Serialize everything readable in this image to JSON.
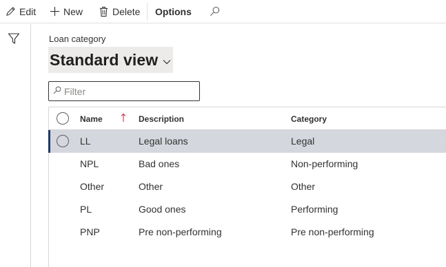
{
  "toolbar": {
    "edit_label": "Edit",
    "new_label": "New",
    "delete_label": "Delete",
    "options_label": "Options"
  },
  "page": {
    "breadcrumb": "Loan category",
    "view_name": "Standard view"
  },
  "filter": {
    "placeholder": "Filter"
  },
  "grid": {
    "columns": {
      "name": "Name",
      "description": "Description",
      "category": "Category"
    },
    "rows": [
      {
        "name": "LL",
        "description": "Legal loans",
        "category": "Legal",
        "selected": true
      },
      {
        "name": "NPL",
        "description": "Bad ones",
        "category": "Non-performing",
        "selected": false
      },
      {
        "name": "Other",
        "description": "Other",
        "category": "Other",
        "selected": false
      },
      {
        "name": "PL",
        "description": "Good ones",
        "category": "Performing",
        "selected": false
      },
      {
        "name": "PNP",
        "description": "Pre non-performing",
        "category": "Pre non-performing",
        "selected": false
      }
    ]
  },
  "colors": {
    "selected_row": "#d4d7de",
    "selection_bar": "#1f3a68",
    "sort_arrow": "#c4314b"
  }
}
